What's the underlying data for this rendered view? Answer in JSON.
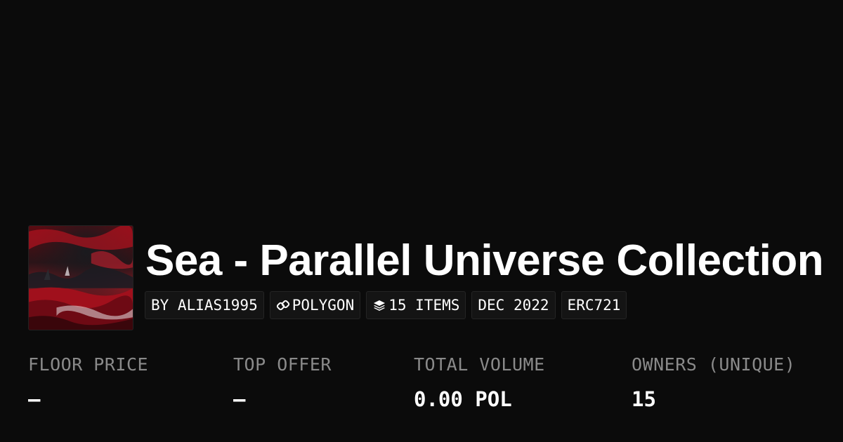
{
  "collection": {
    "title": "Sea - Parallel Universe Collection",
    "image_description_icon": "collection-image"
  },
  "tags": {
    "creator": "BY ALIAS1995",
    "chain": "POLYGON",
    "chain_icon": "polygon-link-icon",
    "items": "15 ITEMS",
    "items_icon": "layers-icon",
    "date": "DEC 2022",
    "standard": "ERC721"
  },
  "stats": {
    "floor_price": {
      "label": "FLOOR PRICE",
      "value": "–"
    },
    "top_offer": {
      "label": "TOP OFFER",
      "value": "–"
    },
    "total_volume": {
      "label": "TOTAL VOLUME",
      "value": "0.00 POL"
    },
    "owners": {
      "label": "OWNERS (UNIQUE)",
      "value": "15"
    }
  },
  "colors": {
    "background": "#0b0b0b",
    "text": "#ffffff",
    "muted": "#8a8a8a",
    "tag_bg": "#141414"
  }
}
